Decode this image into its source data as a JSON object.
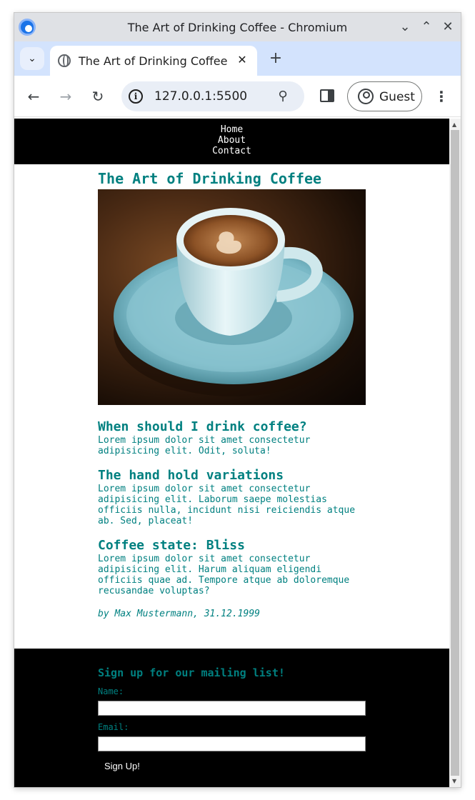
{
  "browser": {
    "window_title": "The Art of Drinking Coffee - Chromium",
    "tab_title": "The Art of Drinking Coffee",
    "url": "127.0.0.1:5500",
    "profile_label": "Guest"
  },
  "nav": {
    "items": [
      "Home",
      "About",
      "Contact"
    ]
  },
  "article": {
    "title": "The Art of Drinking Coffee",
    "sections": [
      {
        "heading": "When should I drink coffee?",
        "body": "Lorem ipsum dolor sit amet consectetur adipisicing elit. Odit, soluta!"
      },
      {
        "heading": "The hand hold variations",
        "body": "Lorem ipsum dolor sit amet consectetur adipisicing elit. Laborum saepe molestias officiis nulla, incidunt nisi reiciendis atque ab. Sed, placeat!"
      },
      {
        "heading": "Coffee state: Bliss",
        "body": "Lorem ipsum dolor sit amet consectetur adipisicing elit. Harum aliquam eligendi officiis quae ad. Tempore atque ab doloremque recusandae voluptas?"
      }
    ],
    "byline": "by Max Mustermann, 31.12.1999"
  },
  "signup": {
    "title": "Sign up for our mailing list!",
    "name_label": "Name:",
    "email_label": "Email:",
    "button_label": "Sign Up!"
  },
  "colors": {
    "accent": "#008080",
    "nav_bg": "#000000",
    "footer_bg": "#000000"
  }
}
